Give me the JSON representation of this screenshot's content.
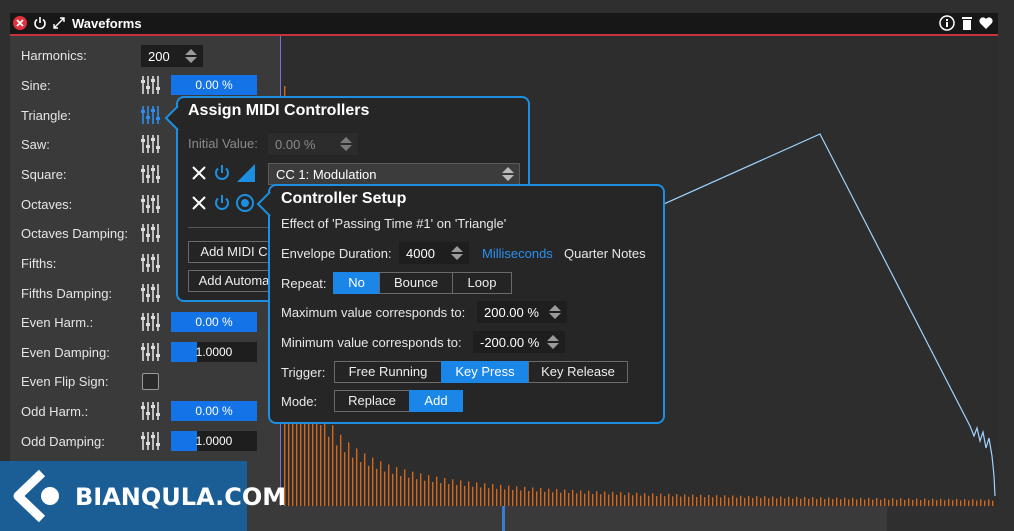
{
  "window": {
    "title": "Waveforms",
    "accent": "#1d8fe0",
    "close_color": "#e0323c"
  },
  "params": {
    "harmonics_label": "Harmonics:",
    "harmonics_value": "200",
    "sine_label": "Sine:",
    "sine_value": "0.00 %",
    "triangle_label": "Triangle:",
    "saw_label": "Saw:",
    "square_label": "Square:",
    "octaves_label": "Octaves:",
    "octaves_damping_label": "Octaves Damping:",
    "fifths_label": "Fifths:",
    "fifths_damping_label": "Fifths Damping:",
    "even_harm_label": "Even Harm.:",
    "even_harm_value": "0.00 %",
    "even_damping_label": "Even Damping:",
    "even_damping_value": "1.0000",
    "even_flip_label": "Even Flip Sign:",
    "odd_harm_label": "Odd Harm.:",
    "odd_harm_value": "0.00 %",
    "odd_damping_label": "Odd Damping:",
    "odd_damping_value": "1.0000"
  },
  "assign_midi": {
    "title": "Assign MIDI Controllers",
    "initial_value_label": "Initial Value:",
    "initial_value": "0.00 %",
    "controller": "CC 1: Modulation",
    "add_midi_label": "Add MIDI C",
    "add_automation_label": "Add Automa"
  },
  "controller_setup": {
    "title": "Controller Setup",
    "subtitle": "Effect of 'Passing Time #1' on 'Triangle'",
    "envelope_label": "Envelope Duration:",
    "envelope_value": "4000",
    "unit_ms": "Milliseconds",
    "unit_qn": "Quarter Notes",
    "repeat_label": "Repeat:",
    "repeat_options": [
      "No",
      "Bounce",
      "Loop"
    ],
    "repeat_selected": "No",
    "max_label": "Maximum value corresponds to:",
    "max_value": "200.00 %",
    "min_label": "Minimum value corresponds to:",
    "min_value": "-200.00 %",
    "trigger_label": "Trigger:",
    "trigger_options": [
      "Free Running",
      "Key Press",
      "Key Release"
    ],
    "trigger_selected": "Key Press",
    "mode_label": "Mode:",
    "mode_options": [
      "Replace",
      "Add"
    ],
    "mode_selected": "Add"
  },
  "logo": {
    "text": "BIANQULA.COM"
  }
}
